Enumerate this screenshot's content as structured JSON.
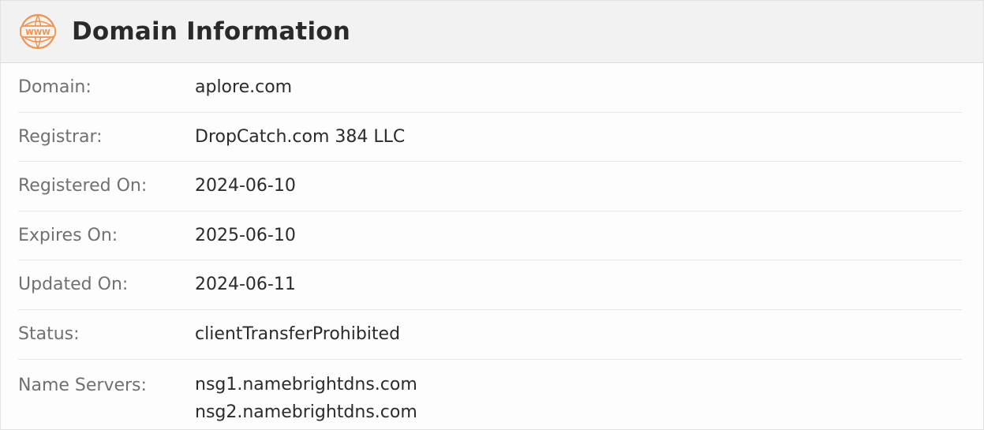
{
  "header": {
    "title": "Domain Information",
    "icon_name": "www-globe-icon",
    "icon_text": "WWW",
    "icon_color": "#f0904a"
  },
  "rows": [
    {
      "label": "Domain:",
      "value": "aplore.com"
    },
    {
      "label": "Registrar:",
      "value": "DropCatch.com 384 LLC"
    },
    {
      "label": "Registered On:",
      "value": "2024-06-10"
    },
    {
      "label": "Expires On:",
      "value": "2025-06-10"
    },
    {
      "label": "Updated On:",
      "value": "2024-06-11"
    },
    {
      "label": "Status:",
      "value": "clientTransferProhibited"
    }
  ],
  "name_servers": {
    "label": "Name Servers:",
    "values": [
      "nsg1.namebrightdns.com",
      "nsg2.namebrightdns.com"
    ]
  }
}
